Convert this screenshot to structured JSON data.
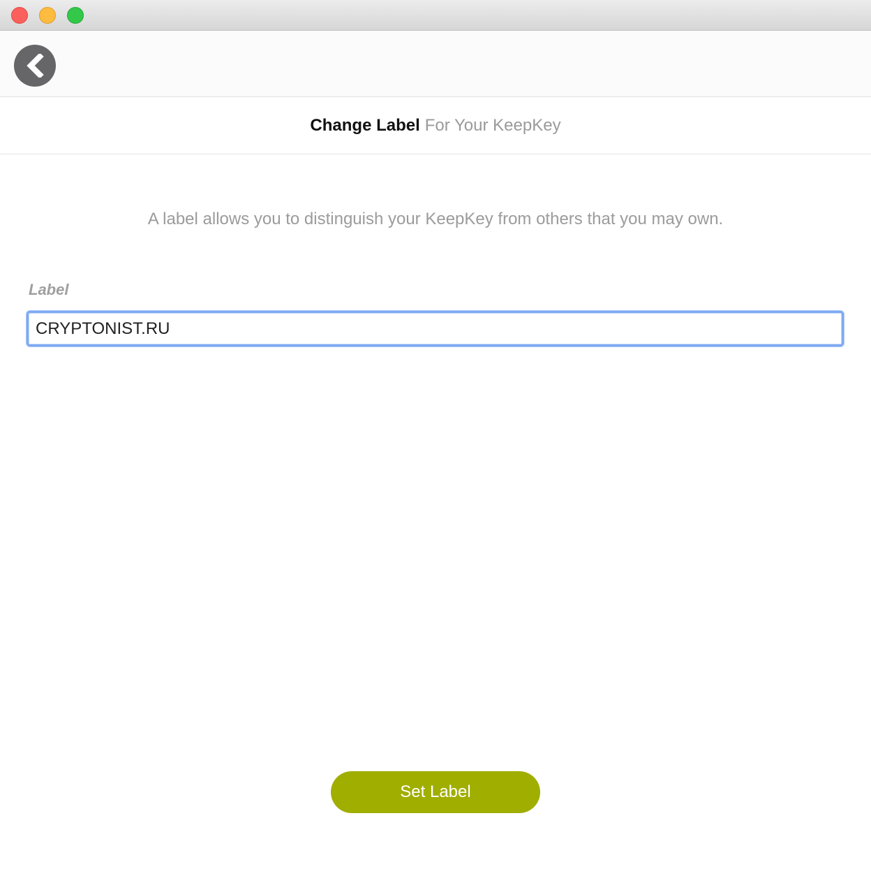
{
  "window": {
    "controls": [
      "close",
      "minimize",
      "maximize"
    ]
  },
  "toolbar": {
    "back_icon": "chevron-left-icon"
  },
  "heading": {
    "strong": "Change Label",
    "light": "For Your KeepKey"
  },
  "description": "A label allows you to distinguish your KeepKey from others that you may own.",
  "form": {
    "label_caption": "Label",
    "label_value": "CRYPTONIST.RU"
  },
  "actions": {
    "submit_label": "Set Label"
  },
  "colors": {
    "accent": "#a0ae00",
    "focus_ring": "#7eaaf4",
    "back_button": "#666669"
  }
}
